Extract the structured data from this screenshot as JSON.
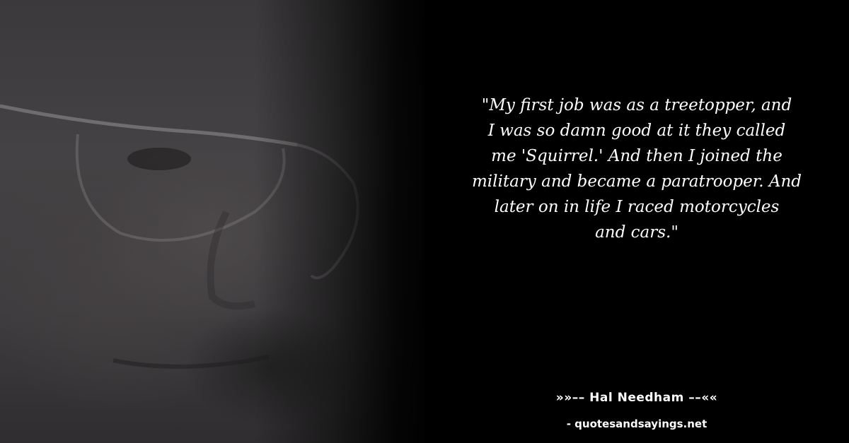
{
  "quote": {
    "text": "\"My first job was as a treetopper, and\nI was so damn good at it they called\nme 'Squirrel.' And then I joined the\nmilitary and became a paratrooper. And\nlater on in life I raced motorcycles\nand cars.\""
  },
  "attribution": {
    "author_line": "»»–– Hal Needham ––««",
    "site": "- quotesandsayings.net"
  },
  "colors": {
    "background": "#000000",
    "text": "#ffffff"
  }
}
